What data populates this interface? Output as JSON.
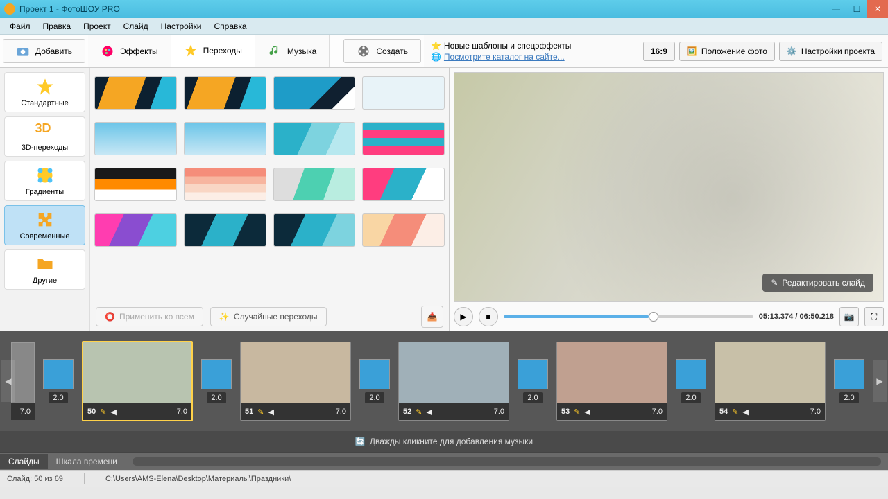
{
  "window": {
    "title": "Проект 1 - ФотоШОУ PRO"
  },
  "menubar": [
    "Файл",
    "Правка",
    "Проект",
    "Слайд",
    "Настройки",
    "Справка"
  ],
  "toolbar": {
    "add": "Добавить",
    "effects": "Эффекты",
    "transitions": "Переходы",
    "music": "Музыка",
    "create": "Создать"
  },
  "promo": {
    "line1": "Новые шаблоны и спецэффекты",
    "line2": "Посмотрите каталог на сайте..."
  },
  "right_toolbar": {
    "aspect": "16:9",
    "position": "Положение фото",
    "settings": "Настройки проекта"
  },
  "categories": [
    {
      "label": "Стандартные",
      "icon": "star"
    },
    {
      "label": "3D-переходы",
      "icon": "3d"
    },
    {
      "label": "Градиенты",
      "icon": "gradient"
    },
    {
      "label": "Современные",
      "icon": "puzzle",
      "active": true
    },
    {
      "label": "Другие",
      "icon": "folder"
    }
  ],
  "thumb_bar": {
    "apply_all": "Применить ко всем",
    "random": "Случайные переходы"
  },
  "preview": {
    "edit_slide": "Редактировать слайд",
    "time_current": "05:13.374",
    "time_total": "06:50.218"
  },
  "timeline": {
    "left_dur": "7.0",
    "transitions_dur": "2.0",
    "frames": [
      {
        "num": "50",
        "dur": "7.0",
        "active": true
      },
      {
        "num": "51",
        "dur": "7.0"
      },
      {
        "num": "52",
        "dur": "7.0"
      },
      {
        "num": "53",
        "dur": "7.0"
      },
      {
        "num": "54",
        "dur": "7.0"
      }
    ],
    "music_hint": "Дважды кликните для добавления музыки"
  },
  "bottom_tabs": {
    "slides": "Слайды",
    "timescale": "Шкала времени"
  },
  "status": {
    "slide": "Слайд: 50 из 69",
    "path": "C:\\Users\\AMS-Elena\\Desktop\\Материалы\\Праздники\\"
  },
  "thumbs": [
    "linear-gradient(110deg,#0c2030 15%,#f5a623 15% 55%,#0c2030 55% 72%,#28b8d8 72%)",
    "linear-gradient(110deg,#0c2030 15%,#f5a623 15% 55%,#0c2030 55% 72%,#28b8d8 72%)",
    "linear-gradient(135deg,#1e9cc8 60%,#102030 60% 80%,#fff 80%)",
    "linear-gradient(#e8f3f8,#e8f3f8)",
    "linear-gradient(#6cc5e8,#c6e7f5)",
    "linear-gradient(#6cc5e8,#c6e7f5)",
    "linear-gradient(115deg,#2bb1c9 40%,#7dd3df 40% 70%,#b7e8ef 70%)",
    "repeating-linear-gradient(0deg,#ff3d7f 0 12px,#2bb1c9 12px 24px)",
    "linear-gradient(#1a1a1a 0 33%,#ff8a00 33% 66%,#fff 66%)",
    "linear-gradient(#f58d7a 0 25%,#f7b59f 25% 50%,#f9d6c4 50% 75%,#fceee6 75%)",
    "linear-gradient(110deg,#ddd 33%,#4dd0b1 33% 66%,#b9ede0 66%)",
    "linear-gradient(115deg,#ff3d7f 33%,#2bb1c9 33% 66%,#fff 66%)",
    "linear-gradient(115deg,#ff3db0 30%,#8a4dd0 30% 60%,#4dd0e1 60%)",
    "linear-gradient(115deg,#0c2a3a 33%,#2bb1c9 33% 66%,#0c2a3a 66%)",
    "linear-gradient(115deg,#0c2a3a 33%,#2bb1c9 33% 66%,#7dd3df 66%)",
    "linear-gradient(115deg,#f9d6a4 33%,#f58d7a 33% 66%,#fceee6 66%)"
  ]
}
